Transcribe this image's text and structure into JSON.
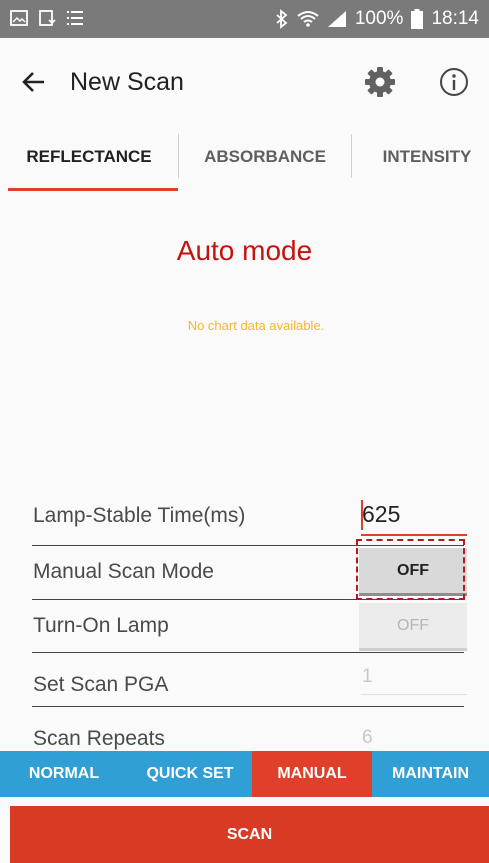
{
  "status_bar": {
    "battery": "100%",
    "time": "18:14"
  },
  "app_bar": {
    "title": "New Scan"
  },
  "tabs": [
    {
      "label": "REFLECTANCE",
      "selected": true
    },
    {
      "label": "ABSORBANCE",
      "selected": false
    },
    {
      "label": "INTENSITY",
      "selected": false
    }
  ],
  "content": {
    "mode_title": "Auto mode",
    "no_data_text": "No chart data available."
  },
  "settings": {
    "lamp_stable_label": "Lamp-Stable Time(ms)",
    "lamp_stable_value": "625",
    "manual_scan_label": "Manual Scan Mode",
    "manual_scan_value": "OFF",
    "turn_on_lamp_label": "Turn-On Lamp",
    "turn_on_lamp_value": "OFF",
    "pga_label": "Set Scan PGA",
    "pga_value": "1",
    "repeats_label": "Scan Repeats",
    "repeats_value": "6"
  },
  "mode_bar": {
    "normal": "NORMAL",
    "quick_set": "QUICK SET",
    "manual": "MANUAL",
    "maintain": "MAINTAIN",
    "active": "MANUAL"
  },
  "scan_button": "SCAN",
  "colors": {
    "accent": "#e0402a",
    "mode_bar": "#2f9fd6",
    "mode_title": "#c3140c",
    "no_data": "#f2b72a"
  }
}
